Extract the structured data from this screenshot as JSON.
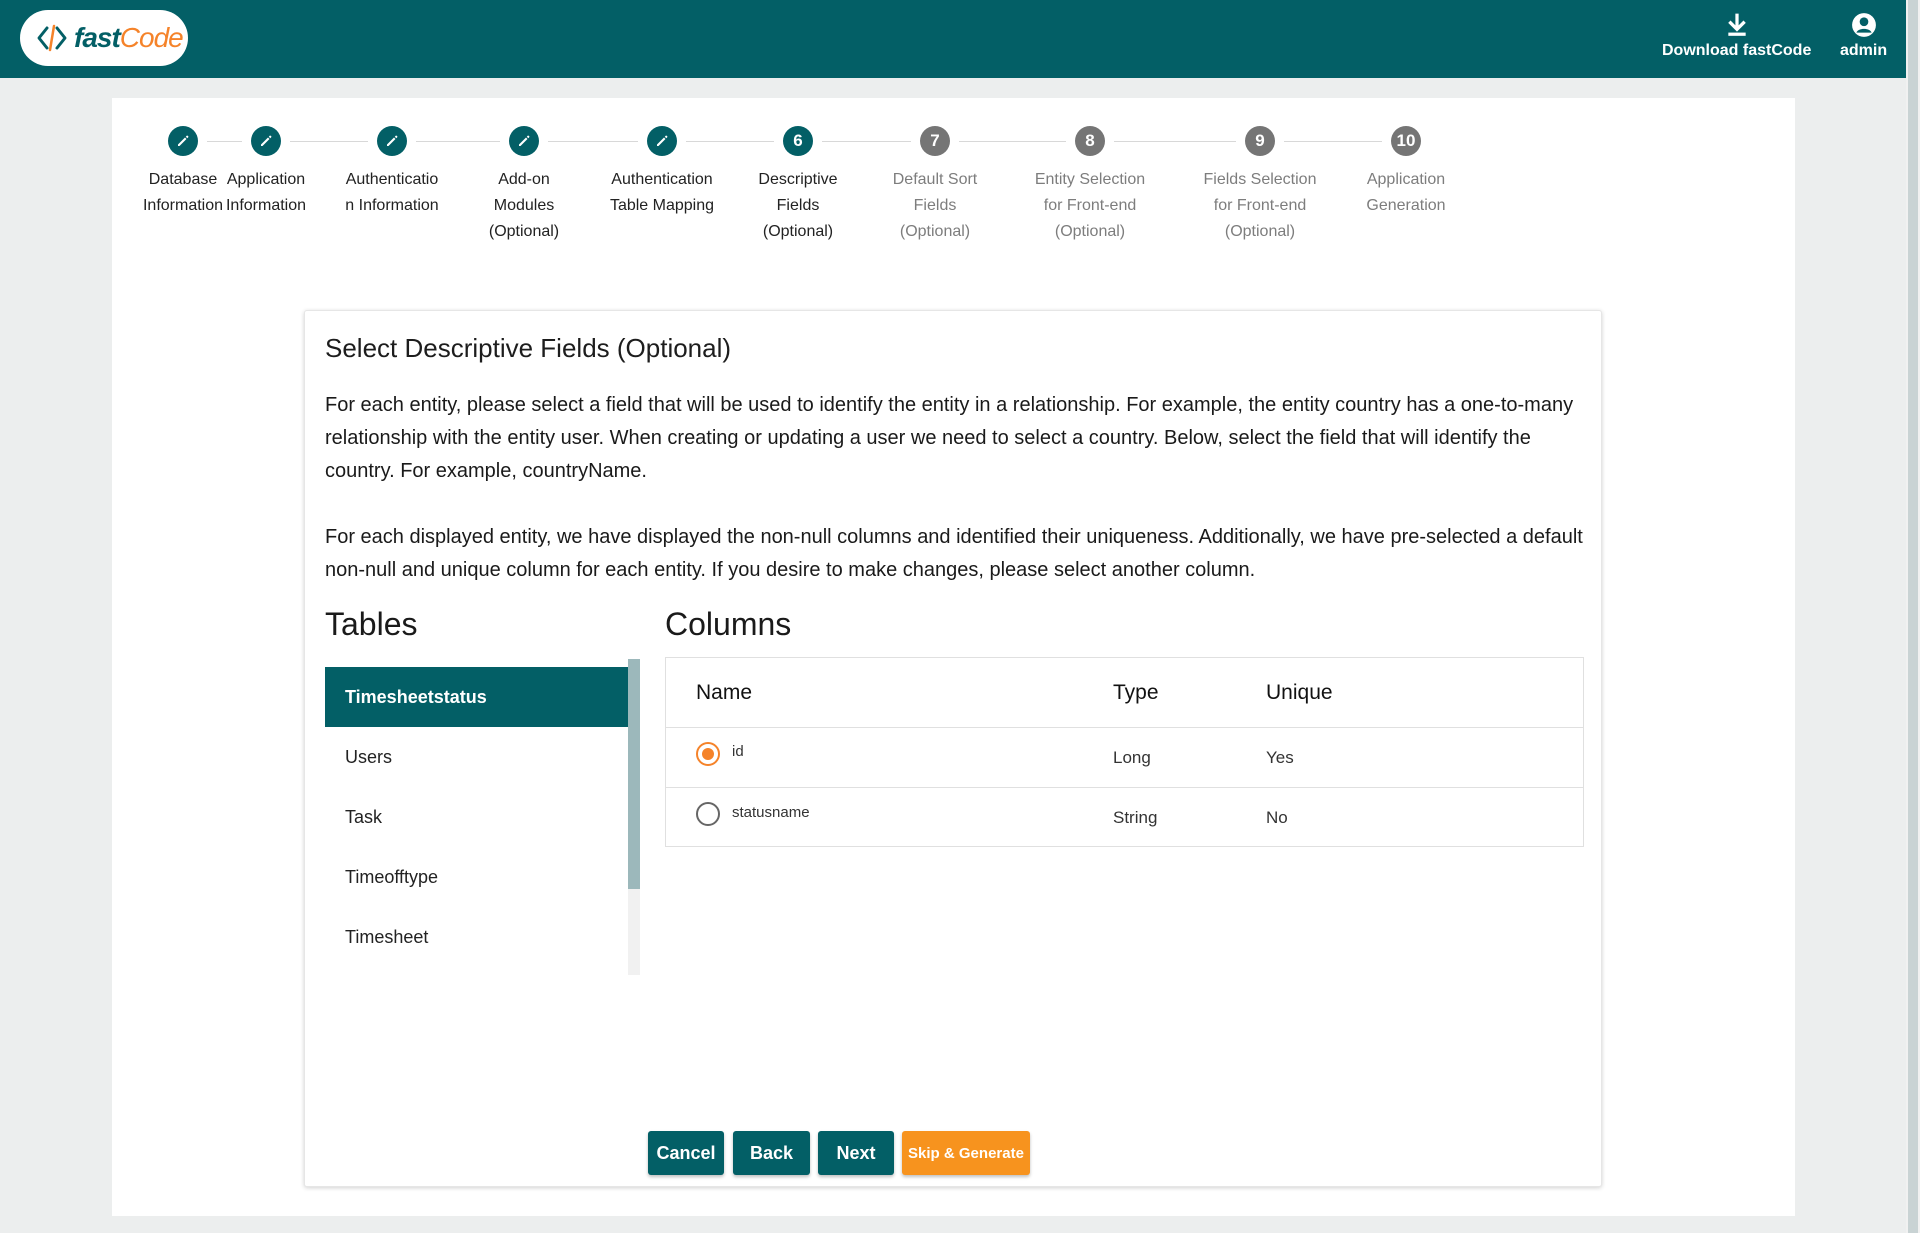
{
  "header": {
    "logo_text_fast": "fast",
    "logo_text_code": "Code",
    "download_label": "Download fastCode",
    "admin_label": "admin"
  },
  "stepper": {
    "steps": [
      {
        "id": "1",
        "label": "Database Information",
        "state": "done"
      },
      {
        "id": "2",
        "label": "Application Information",
        "state": "done"
      },
      {
        "id": "3",
        "label": "Authenticatio n Information",
        "state": "done"
      },
      {
        "id": "4",
        "label": "Add-on Modules (Optional)",
        "state": "done"
      },
      {
        "id": "5",
        "label": "Authentication Table Mapping",
        "state": "done"
      },
      {
        "id": "6",
        "label": "Descriptive Fields (Optional)",
        "state": "active"
      },
      {
        "id": "7",
        "label": "Default Sort Fields (Optional)",
        "state": "todo"
      },
      {
        "id": "8",
        "label": "Entity Selection for Front-end (Optional)",
        "state": "todo"
      },
      {
        "id": "9",
        "label": "Fields Selection for Front-end (Optional)",
        "state": "todo"
      },
      {
        "id": "10",
        "label": "Application Generation",
        "state": "todo"
      }
    ]
  },
  "card": {
    "title": "Select Descriptive Fields (Optional)",
    "paragraph1": "For each entity, please select a field that will be used to identify the entity in a relationship. For example, the entity country has a one-to-many relationship with the entity user. When creating or updating a user we need to select a country. Below, select the field that will identify the country. For example, countryName.",
    "paragraph2": "For each displayed entity, we have displayed the non-null columns and identified their uniqueness. Additionally, we have pre-selected a default non-null and unique column for each entity. If you desire to make changes, please select another column.",
    "tables_heading": "Tables",
    "columns_heading": "Columns"
  },
  "tables": {
    "items": [
      "Timesheetstatus",
      "Users",
      "Task",
      "Timeofftype",
      "Timesheet"
    ],
    "selected": "Timesheetstatus"
  },
  "columns": {
    "headers": {
      "name": "Name",
      "type": "Type",
      "unique": "Unique"
    },
    "rows": [
      {
        "name": "id",
        "type": "Long",
        "unique": "Yes",
        "selected": true
      },
      {
        "name": "statusname",
        "type": "String",
        "unique": "No",
        "selected": false
      }
    ]
  },
  "buttons": {
    "cancel": "Cancel",
    "back": "Back",
    "next": "Next",
    "skip": "Skip & Generate"
  },
  "colors": {
    "primary": "#035f66",
    "accent": "#f7931e",
    "inactive_step": "#757575"
  }
}
